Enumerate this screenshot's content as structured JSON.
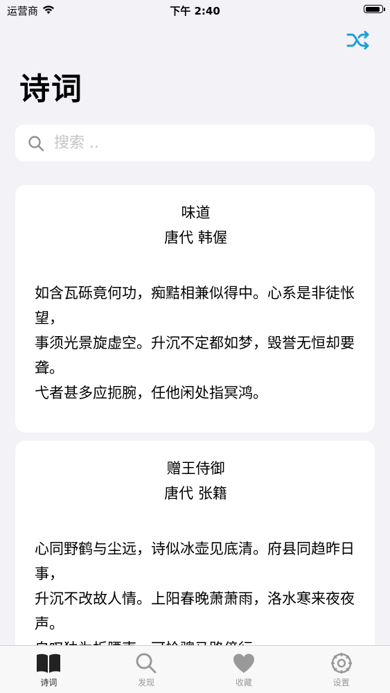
{
  "status_bar": {
    "carrier": "运营商",
    "time": "下午 2:40"
  },
  "header": {
    "title": "诗词",
    "shuffle_icon": "shuffle-icon",
    "accent_color": "#1a9fd8"
  },
  "search": {
    "placeholder": "搜索 .."
  },
  "poems": [
    {
      "title": "味道",
      "author": "唐代 韩偓",
      "body": "如含瓦砾竟何功，痴黠相兼似得中。心系是非徒怅望，\n事须光景旋虚空。升沉不定都如梦，毁誉无恒却要聋。\n弋者甚多应扼腕，任他闲处指冥鸿。"
    },
    {
      "title": "赠王侍御",
      "author": "唐代 张籍",
      "body": "心同野鹤与尘远，诗似冰壶见底清。府县同趋昨日事，\n升沉不改故人情。上阳春晚萧萧雨，洛水寒来夜夜声。\n自叹独为折腰吏，可怜骢马路傍行。"
    }
  ],
  "tab_bar": {
    "items": [
      {
        "label": "诗词",
        "icon": "book-icon",
        "active": true
      },
      {
        "label": "发现",
        "icon": "search-icon",
        "active": false
      },
      {
        "label": "收藏",
        "icon": "heart-icon",
        "active": false
      },
      {
        "label": "设置",
        "icon": "gear-icon",
        "active": false
      }
    ]
  }
}
